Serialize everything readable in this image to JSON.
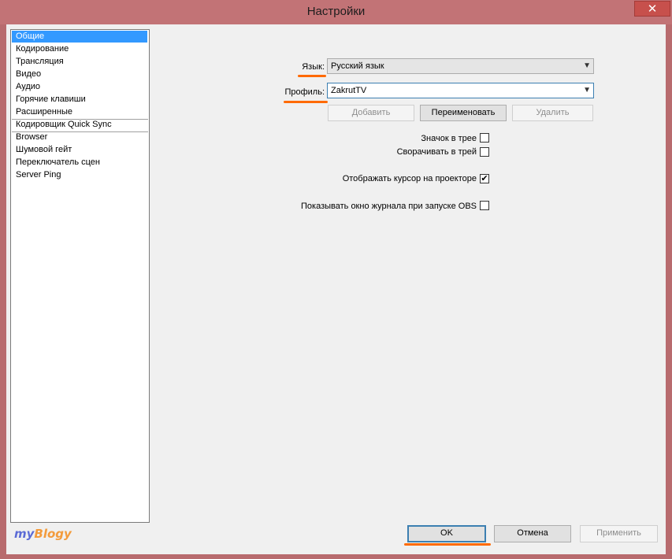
{
  "window": {
    "title": "Настройки",
    "close_glyph": "✕"
  },
  "sidebar": {
    "items": [
      {
        "label": "Общие",
        "selected": true
      },
      {
        "label": "Кодирование"
      },
      {
        "label": "Трансляция"
      },
      {
        "label": "Видео"
      },
      {
        "label": "Аудио"
      },
      {
        "label": "Горячие клавиши"
      },
      {
        "label": "Расширенные"
      },
      {
        "label": "Кодировщик Quick Sync"
      },
      {
        "label": "Browser"
      },
      {
        "label": "Шумовой гейт"
      },
      {
        "label": "Переключатель сцен"
      },
      {
        "label": "Server Ping"
      }
    ]
  },
  "general": {
    "language_label": "Язык:",
    "language_value": "Русский язык",
    "profile_label": "Профиль:",
    "profile_value": "ZakrutTV",
    "add_button": "Добавить",
    "rename_button": "Переименовать",
    "delete_button": "Удалить",
    "tray_icon_label": "Значок в трее",
    "tray_icon_checked": false,
    "minimize_tray_label": "Сворачивать в трей",
    "minimize_tray_checked": false,
    "projector_cursor_label": "Отображать курсор на проекторе",
    "projector_cursor_checked": true,
    "show_log_label": "Показывать окно журнала при запуске OBS",
    "show_log_checked": false,
    "check_glyph": "✔",
    "arrow_glyph": "▼"
  },
  "footer": {
    "ok_button": "OK",
    "cancel_button": "Отмена",
    "apply_button": "Применить"
  },
  "watermark": {
    "my": "my",
    "blogy": "Blogy"
  },
  "colors": {
    "selection": "#3399ff",
    "annotation": "#ff6a00",
    "frame": "#c27376"
  }
}
